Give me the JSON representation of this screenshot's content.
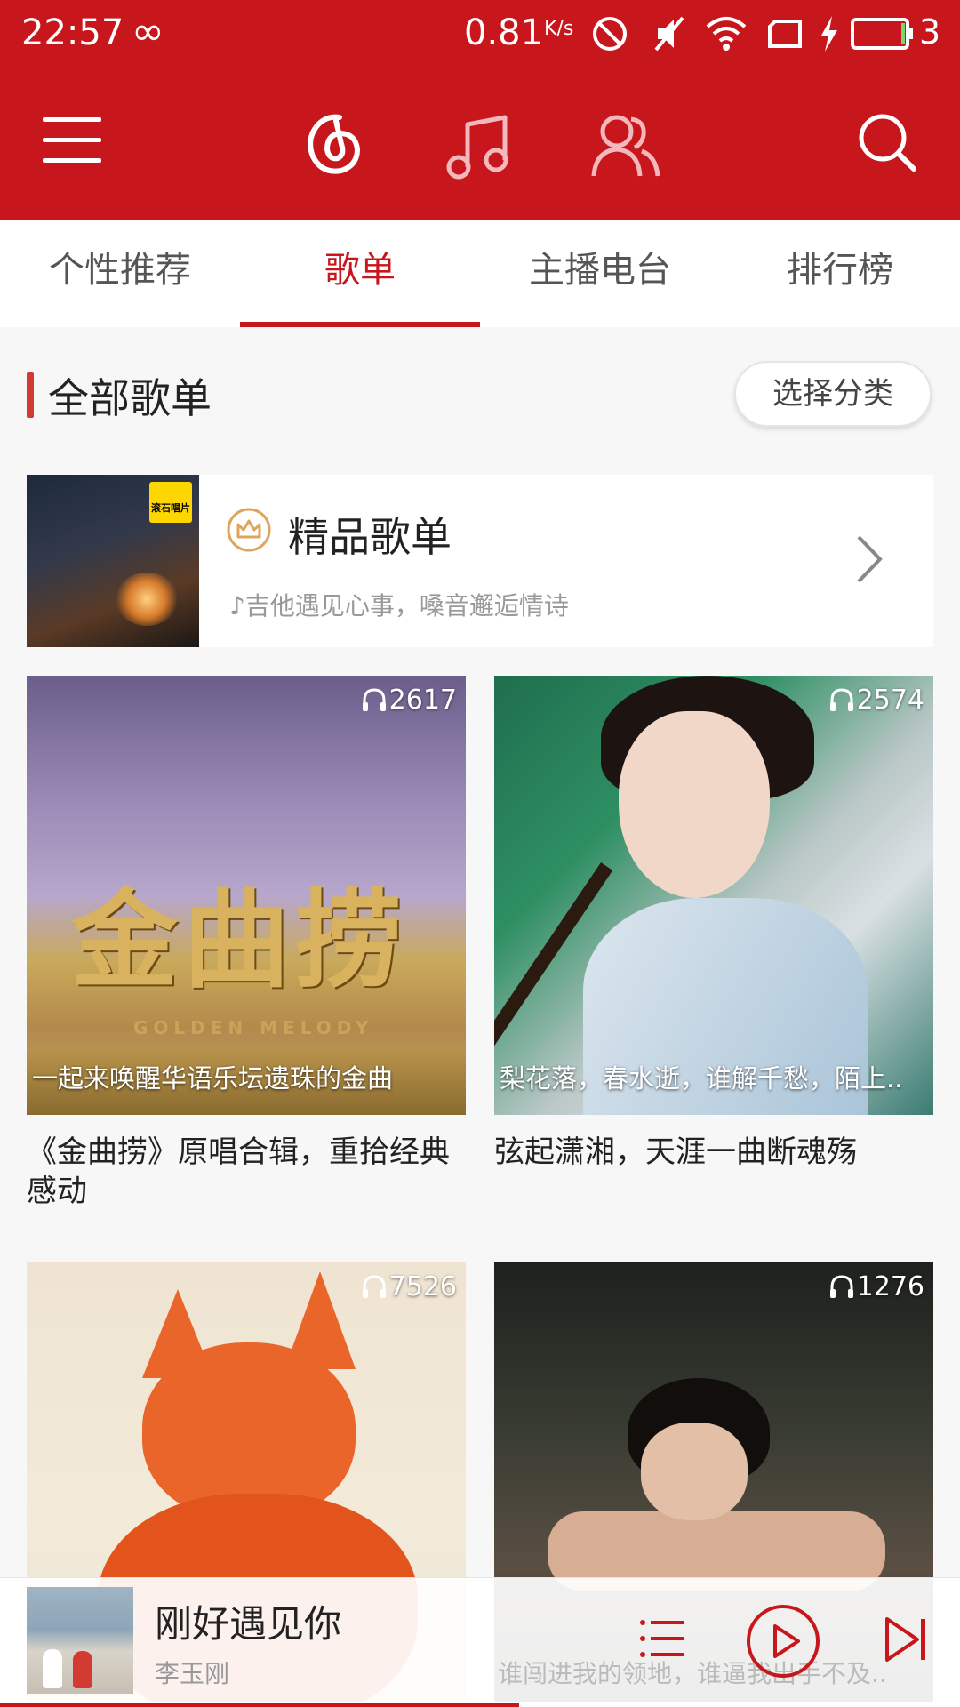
{
  "status_bar": {
    "time": "22:57",
    "speed_value": "0.81",
    "speed_unit": "K/s",
    "battery_text": "3"
  },
  "colors": {
    "brand_red": "#c8161d",
    "accent_orange": "#e1a45a"
  },
  "app_bar": {
    "icons": [
      "menu-icon",
      "netease-logo-icon",
      "music-note-icon",
      "friends-icon",
      "search-icon"
    ]
  },
  "tabs": [
    {
      "label": "个性推荐",
      "active": false
    },
    {
      "label": "歌单",
      "active": true
    },
    {
      "label": "主播电台",
      "active": false
    },
    {
      "label": "排行榜",
      "active": false
    }
  ],
  "section": {
    "title": "全部歌单",
    "select_button": "选择分类"
  },
  "premium": {
    "thumb_logo": "滚石唱片",
    "title": "精品歌单",
    "subtitle": "吉他遇见心事，嗓音邂逅情诗"
  },
  "playlists": [
    {
      "play_count": "2617",
      "cover_text": "金曲捞",
      "cover_sub": "GOLDEN MELODY",
      "cover_caption": "一起来唤醒华语乐坛遗珠的金曲",
      "title": "《金曲捞》原唱合辑，重拾经典感动"
    },
    {
      "play_count": "2574",
      "cover_caption": "梨花落，春水逝，谁解千愁，陌上..",
      "title": "弦起潇湘，天涯一曲断魂殇"
    },
    {
      "play_count": "7526",
      "cover_caption": "",
      "title": ""
    },
    {
      "play_count": "1276",
      "cover_caption": "",
      "title": ""
    }
  ],
  "player": {
    "song": "刚好遇见你",
    "artist": "李玉刚",
    "ghost_caption": "谁闯进我的领地，谁逼我出手不及.."
  }
}
